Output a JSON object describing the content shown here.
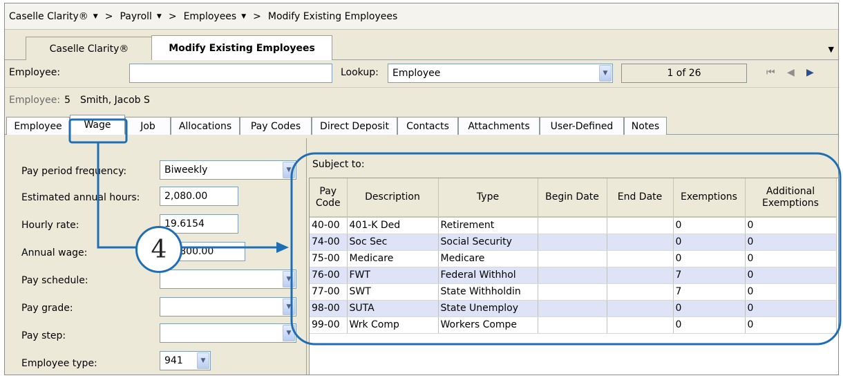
{
  "breadcrumb": {
    "items": [
      "Caselle Clarity®",
      "Payroll",
      "Employees",
      "Modify Existing Employees"
    ],
    "caret": "▼",
    "separator": ">"
  },
  "doc_tabs": {
    "tabs": [
      "Caselle Clarity®",
      "Modify Existing Employees"
    ],
    "active": 1,
    "overflow_arrow": "▼"
  },
  "employee_bar": {
    "label": "Employee:",
    "value": "",
    "lookup_label": "Lookup:",
    "lookup_value": "Employee",
    "record_counter": "1 of 26"
  },
  "employee_info": {
    "label": "Employee:",
    "number": "5",
    "name": "Smith, Jacob S"
  },
  "section_tabs": {
    "tabs": [
      "Employee",
      "Wage",
      "Job",
      "Allocations",
      "Pay Codes",
      "Direct Deposit",
      "Contacts",
      "Attachments",
      "User-Defined",
      "Notes"
    ],
    "active": "Wage"
  },
  "wage_form": {
    "pay_period_frequency_label": "Pay period frequency:",
    "pay_period_frequency_value": "Biweekly",
    "estimated_annual_hours_label": "Estimated annual hours:",
    "estimated_annual_hours_value": "2,080.00",
    "hourly_rate_label": "Hourly rate:",
    "hourly_rate_value": "19.6154",
    "annual_wage_label": "Annual wage:",
    "annual_wage_value": "40,800.00",
    "pay_schedule_label": "Pay schedule:",
    "pay_schedule_value": "",
    "pay_grade_label": "Pay grade:",
    "pay_grade_value": "",
    "pay_step_label": "Pay step:",
    "pay_step_value": "",
    "employee_type_label": "Employee type:",
    "employee_type_value": "941"
  },
  "subject_to": {
    "title": "Subject to:",
    "columns": [
      "Pay Code",
      "Description",
      "Type",
      "Begin Date",
      "End Date",
      "Exemptions",
      "Additional Exemptions"
    ],
    "rows": [
      [
        "40-00",
        "401-K Ded",
        "Retirement",
        "",
        "",
        "0",
        "0"
      ],
      [
        "74-00",
        "Soc Sec",
        "Social Security",
        "",
        "",
        "0",
        "0"
      ],
      [
        "75-00",
        "Medicare",
        "Medicare",
        "",
        "",
        "0",
        "0"
      ],
      [
        "76-00",
        "FWT",
        "Federal Withhol",
        "",
        "",
        "7",
        "0"
      ],
      [
        "77-00",
        "SWT",
        "State Withholdin",
        "",
        "",
        "7",
        "0"
      ],
      [
        "98-00",
        "SUTA",
        "State Unemploy",
        "",
        "",
        "0",
        "0"
      ],
      [
        "99-00",
        "Wrk Comp",
        "Workers Compe",
        "",
        "",
        "0",
        "0"
      ]
    ]
  },
  "annotation": {
    "step_number": "4",
    "accent_color": "#1f6db4"
  }
}
